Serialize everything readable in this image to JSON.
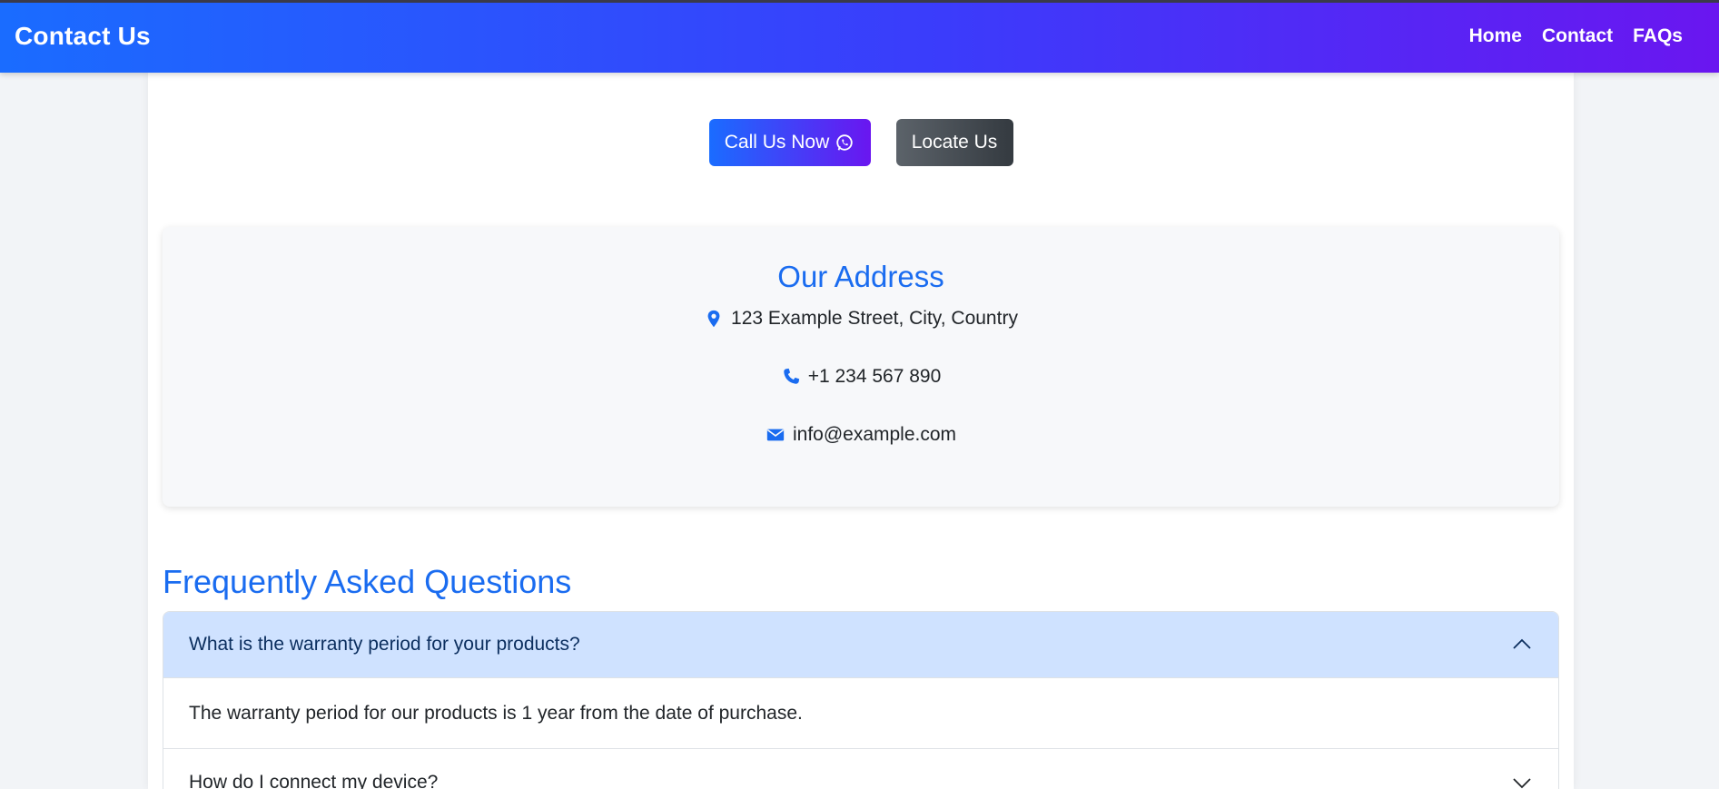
{
  "navbar": {
    "brand": "Contact Us",
    "links": [
      "Home",
      "Contact",
      "FAQs"
    ]
  },
  "actions": {
    "call_label": "Call Us Now",
    "locate_label": "Locate Us"
  },
  "address_card": {
    "title": "Our Address",
    "address": "123 Example Street, City, Country",
    "phone": "+1 234 567 890",
    "email": "info@example.com"
  },
  "faq": {
    "title": "Frequently Asked Questions",
    "items": [
      {
        "question": "What is the warranty period for your products?",
        "answer": "The warranty period for our products is 1 year from the date of purchase.",
        "expanded": true
      },
      {
        "question": "How do I connect my device?",
        "expanded": false
      }
    ]
  },
  "icons": {
    "call": "whatsapp-icon",
    "address": "map-marker-icon",
    "phone": "phone-icon",
    "email": "envelope-icon",
    "expanded": "chevron-up-icon",
    "collapsed": "chevron-down-icon"
  },
  "colors": {
    "accent": "#1a6cf0",
    "gradient_start": "#1a6cff",
    "gradient_end": "#6a16f0",
    "accordion_open_bg": "#cfe2ff"
  }
}
